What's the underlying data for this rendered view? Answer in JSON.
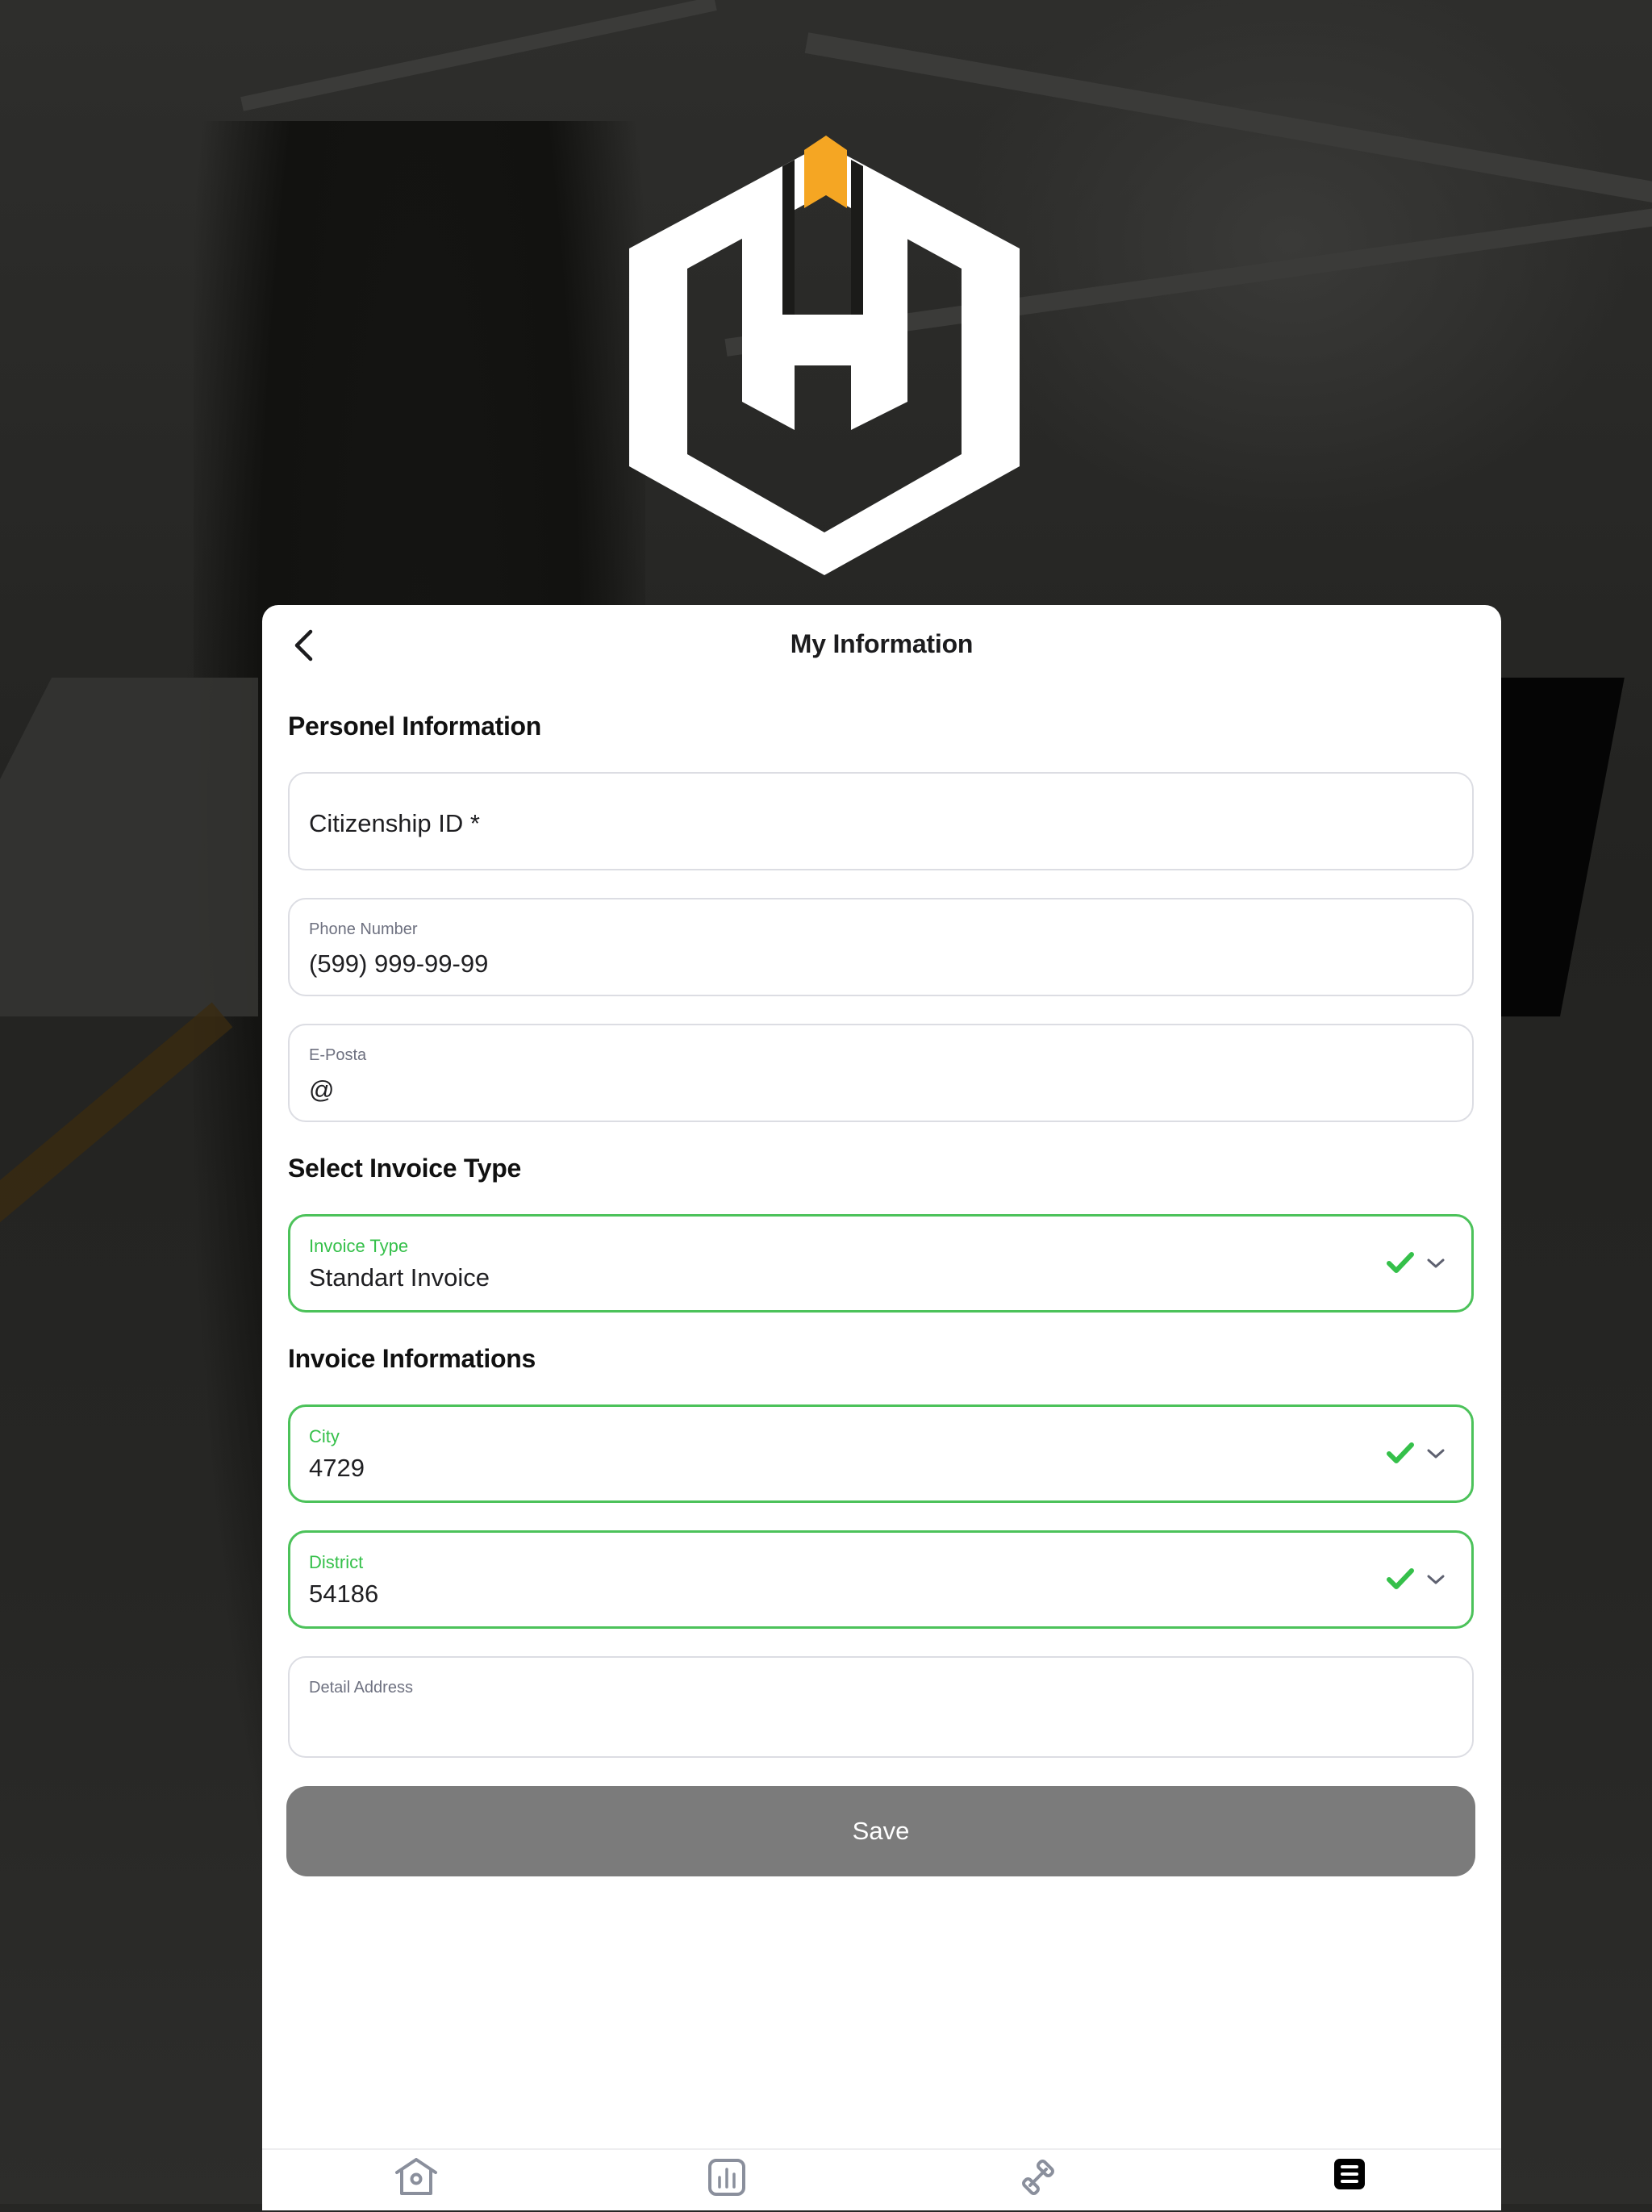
{
  "app": {
    "brand_logo": "hexagon-h-logo",
    "colors": {
      "accent_orange": "#f5a623",
      "valid_green": "#35c04a",
      "save_button_bg": "#7b7b7b",
      "border_neutral": "#dcdde3",
      "icon_inactive": "#8a8f9c",
      "icon_active": "#000000"
    }
  },
  "header": {
    "back_icon": "chevron-left-icon",
    "title": "My Information"
  },
  "sections": {
    "personal": "Personel Information",
    "invoice_type": "Select Invoice Type",
    "invoice_info": "Invoice Informations"
  },
  "fields": {
    "citizenship_id": {
      "placeholder": "Citizenship ID *",
      "value": ""
    },
    "phone": {
      "label": "Phone Number",
      "value": "(599) 999-99-99"
    },
    "email": {
      "label": "E-Posta",
      "value": "@"
    },
    "invoice_type": {
      "label": "Invoice Type",
      "value": "Standart Invoice",
      "valid": true
    },
    "city": {
      "label": "City",
      "value": "4729",
      "valid": true
    },
    "district": {
      "label": "District",
      "value": "54186",
      "valid": true
    },
    "detail_address": {
      "label": "Detail Address",
      "value": ""
    }
  },
  "actions": {
    "save_label": "Save"
  },
  "tabbar": {
    "items": [
      {
        "name": "home",
        "icon": "home-icon",
        "active": false
      },
      {
        "name": "stats",
        "icon": "bar-chart-icon",
        "active": false
      },
      {
        "name": "workout",
        "icon": "dumbbell-icon",
        "active": false
      },
      {
        "name": "menu",
        "icon": "menu-icon",
        "active": true
      }
    ]
  }
}
